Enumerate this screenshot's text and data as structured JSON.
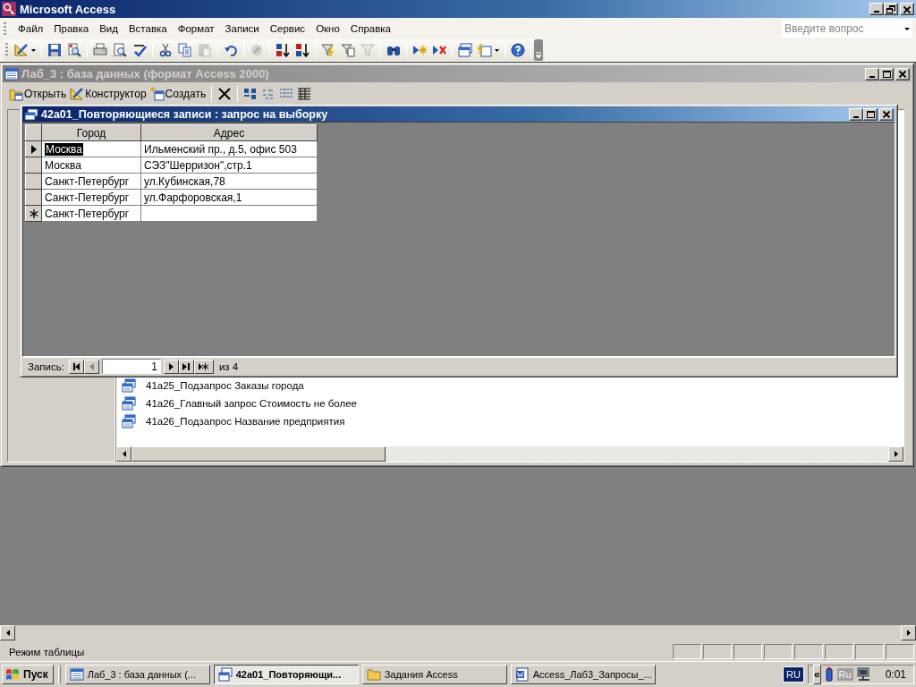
{
  "window": {
    "title": "Microsoft Access"
  },
  "menu": [
    "Файл",
    "Правка",
    "Вид",
    "Вставка",
    "Формат",
    "Записи",
    "Сервис",
    "Окно",
    "Справка"
  ],
  "help_box": {
    "placeholder": "Введите вопрос"
  },
  "toolbar_buttons": [
    {
      "disabled": false
    },
    {
      "disabled": false
    },
    {
      "disabled": false
    },
    {
      "disabled": false
    },
    {
      "disabled": false
    },
    {
      "disabled": false
    },
    {
      "disabled": false
    },
    {
      "disabled": false
    },
    {
      "disabled": true
    },
    {
      "disabled": false
    },
    {
      "disabled": true
    },
    {
      "disabled": false
    },
    {
      "disabled": false
    },
    {
      "disabled": false
    },
    {
      "disabled": false
    },
    {
      "disabled": true
    },
    {
      "disabled": false
    },
    {
      "disabled": false
    },
    {
      "disabled": false
    },
    {
      "disabled": false
    },
    {
      "disabled": false
    },
    {
      "disabled": false
    }
  ],
  "database_window": {
    "title": "Лаб_3 : база данных (формат Access 2000)",
    "toolbar": [
      {
        "kind": "open",
        "label": "Открыть"
      },
      {
        "kind": "design",
        "label": "Конструктор"
      },
      {
        "kind": "new",
        "label": "Создать"
      }
    ],
    "list_items": [
      "41a25_Подзапрос Заказы города",
      "41a26_Главный запрос Стоимость не более",
      "41a26_Подзапрос Название предприятия"
    ]
  },
  "query_window": {
    "title": "42a01_Повторяющиеся записи : запрос на выборку",
    "columns": [
      "Город",
      "Адрес"
    ],
    "rows": [
      {
        "kind": "current",
        "cells": [
          "Москва",
          "Ильменский пр., д.5, офис 503"
        ]
      },
      {
        "kind": "record",
        "cells": [
          "Москва",
          "СЭЗ\"Шерризон\",стр.1"
        ]
      },
      {
        "kind": "record",
        "cells": [
          "Санкт-Петербург",
          "ул.Кубинская,78"
        ]
      },
      {
        "kind": "record",
        "cells": [
          "Санкт-Петербург",
          "ул.Фарфоровская,1"
        ]
      },
      {
        "kind": "new",
        "cells": [
          "Санкт-Петербург",
          ""
        ]
      }
    ],
    "navigation": {
      "label": "Запись:",
      "current": "1",
      "total": "из 4",
      "buttons": [
        {
          "kind": "first",
          "disabled": false
        },
        {
          "kind": "prev",
          "disabled": true
        },
        {
          "kind": "next",
          "disabled": false
        },
        {
          "kind": "last",
          "disabled": false
        },
        {
          "kind": "new",
          "disabled": false
        }
      ]
    }
  },
  "status_bar": {
    "text": "Режим таблицы"
  },
  "taskbar": {
    "start": "Пуск",
    "tasks": [
      {
        "kind": "database",
        "label": "Лаб_3 : база данных (...",
        "selected": false
      },
      {
        "kind": "query",
        "label": "42a01_Повторяющи...",
        "selected": true
      },
      {
        "kind": "folder",
        "label": "Задания Access",
        "selected": false
      },
      {
        "kind": "document",
        "label": "Access_Лаб3_Запросы_...",
        "selected": false
      }
    ],
    "language": "RU",
    "tray_toggle": "«",
    "tray_language": "Ru",
    "clock": "0:01"
  }
}
